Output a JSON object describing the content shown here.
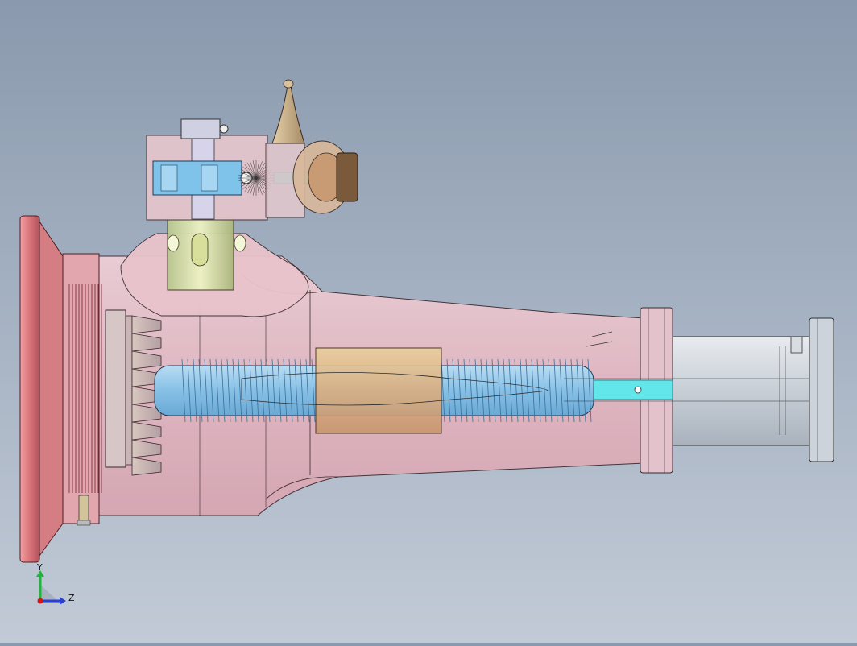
{
  "viewport": {
    "background_top": "#8a99ad",
    "background_bottom": "#c2cad6"
  },
  "model": {
    "housing_color": "#e6b9c2",
    "flange_color": "#d8707a",
    "thread_color": "#8ec7e8",
    "nut_color": "#e2b98c",
    "shaft_color": "#cdd3da",
    "cyan_color": "#63e6ea",
    "cone_color": "#c7ad86",
    "knob_color": "#7b5a3c"
  },
  "triad": {
    "y_label": "Y",
    "z_label": "Z",
    "y_color": "#1fb43a",
    "z_color": "#2a3fd6",
    "origin_color": "#d01818"
  }
}
